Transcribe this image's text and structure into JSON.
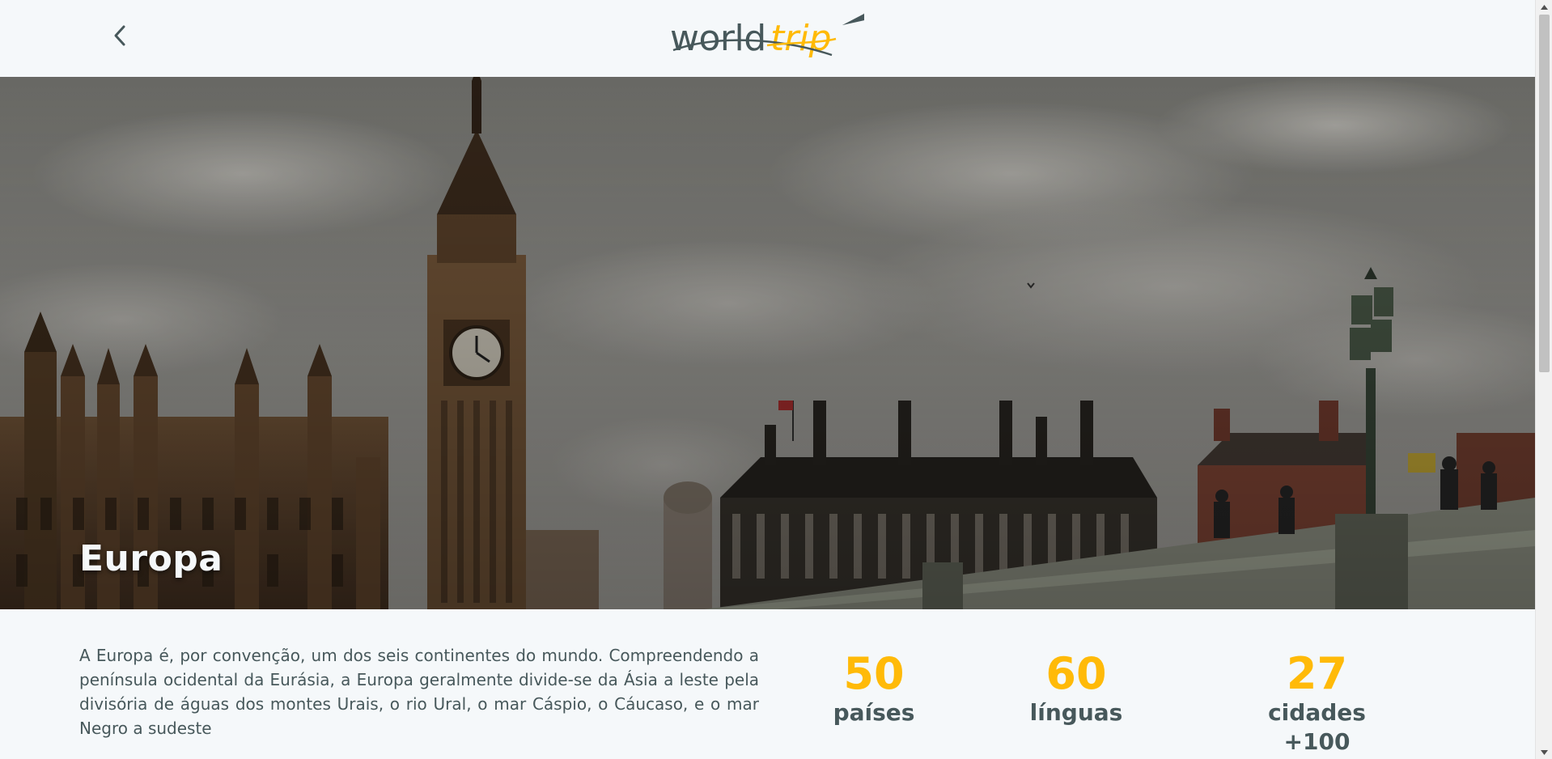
{
  "header": {
    "logo_text_world": "world",
    "logo_text_trip": "trip",
    "back_icon": "chevron-left-icon",
    "logo_icon": "airplane-icon"
  },
  "banner": {
    "title": "Europa"
  },
  "content": {
    "description": "A Europa é, por convenção, um dos seis continentes do mundo. Compreendendo a península ocidental da Eurásia, a Europa geralmente divide-se da Ásia a leste pela divisória de águas dos montes Urais, o rio Ural, o mar Cáspio, o Cáucaso, e o mar Negro a sudeste",
    "stats": [
      {
        "value": "50",
        "label": "países"
      },
      {
        "value": "60",
        "label": "línguas"
      },
      {
        "value": "27",
        "label": "cidades +100"
      }
    ]
  },
  "colors": {
    "accent": "#ffba08",
    "text": "#47585b",
    "background": "#f5f8fa",
    "light_text": "#f5f8fa"
  }
}
